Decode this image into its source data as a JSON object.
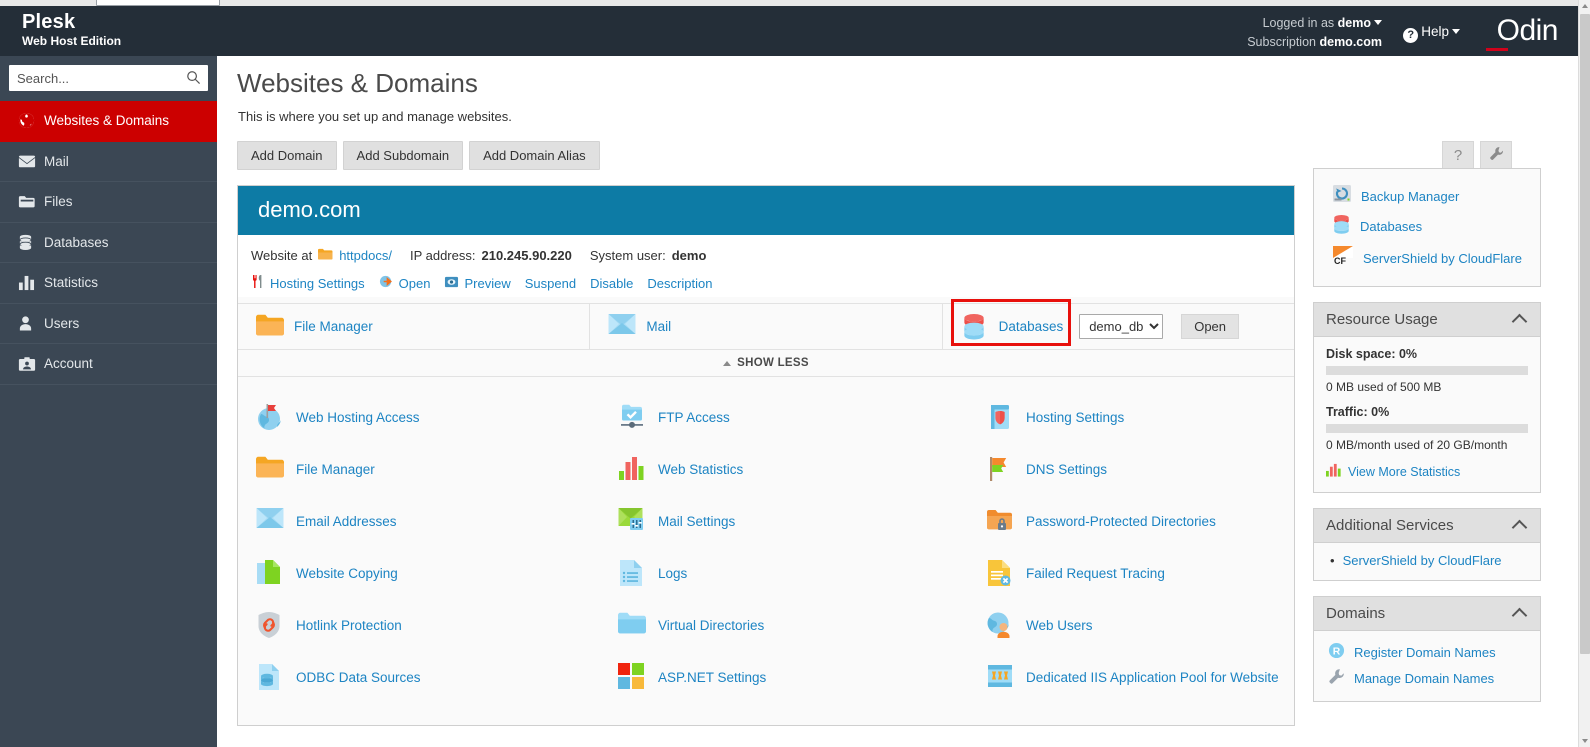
{
  "browser": {
    "strip": ""
  },
  "topbar": {
    "brand_name": "Plesk",
    "brand_sub": "Web Host Edition",
    "logged_in_label": "Logged in as",
    "logged_in_user": "demo",
    "subscription_label": "Subscription",
    "subscription_value": "demo.com",
    "help_label": "Help",
    "logo": "Odin",
    "accent_red": "#d0021b",
    "bg": "#242e38"
  },
  "sidebar": {
    "search": {
      "placeholder": "Search...",
      "value": "",
      "icon": "search-icon"
    },
    "active_color": "#cc0000",
    "bg": "#3b4754",
    "items": [
      {
        "label": "Websites & Domains",
        "icon": "globe-icon",
        "active": true
      },
      {
        "label": "Mail",
        "icon": "envelope-icon",
        "active": false
      },
      {
        "label": "Files",
        "icon": "folder-icon",
        "active": false
      },
      {
        "label": "Databases",
        "icon": "database-icon",
        "active": false
      },
      {
        "label": "Statistics",
        "icon": "bar-chart-icon",
        "active": false
      },
      {
        "label": "Users",
        "icon": "user-icon",
        "active": false
      },
      {
        "label": "Account",
        "icon": "account-card-icon",
        "active": false
      }
    ]
  },
  "main": {
    "page_title": "Websites & Domains",
    "page_description": "This is where you set up and manage websites.",
    "buttons": [
      {
        "label": "Add Domain"
      },
      {
        "label": "Add Subdomain"
      },
      {
        "label": "Add Domain Alias"
      }
    ],
    "square_buttons": [
      {
        "label": "?",
        "icon": "question-mark-icon"
      },
      {
        "label": "",
        "icon": "wrench-icon"
      }
    ]
  },
  "domain_panel": {
    "header_bg": "#0d7ba5",
    "title": "demo.com",
    "website_at_label": "Website at",
    "webroot": "httpdocs/",
    "ip_label": "IP address:",
    "ip_value": "210.245.90.220",
    "system_user_label": "System user:",
    "system_user_value": "demo",
    "actions": [
      {
        "label": "Hosting Settings",
        "icon": "tools-icon",
        "link": true
      },
      {
        "label": "Open",
        "icon": "open-arrow-icon",
        "link": true
      },
      {
        "label": "Preview",
        "icon": "preview-eye-icon",
        "link": true
      },
      {
        "label": "Suspend",
        "icon": "",
        "link": true
      },
      {
        "label": "Disable",
        "icon": "",
        "link": true
      },
      {
        "label": "Description",
        "icon": "",
        "link": true
      }
    ],
    "tools": [
      {
        "label": "File Manager",
        "icon": "folder-orange-icon"
      },
      {
        "label": "Mail",
        "icon": "envelope-blue-icon"
      },
      {
        "label": "Databases",
        "icon": "database-red-blue-icon",
        "highlighted": true
      }
    ],
    "highlight_color": "#e8100c",
    "db_select": {
      "value": "demo_db",
      "options": [
        "demo_db"
      ]
    },
    "open_button": "Open",
    "show_less": "SHOW LESS",
    "grid_items": [
      {
        "label": "Web Hosting Access",
        "icon": "globe-flag-icon"
      },
      {
        "label": "FTP Access",
        "icon": "ftp-folder-check-icon"
      },
      {
        "label": "Hosting Settings",
        "icon": "shield-panel-icon"
      },
      {
        "label": "File Manager",
        "icon": "folder-orange-icon"
      },
      {
        "label": "Web Statistics",
        "icon": "bar-chart-color-icon"
      },
      {
        "label": "DNS Settings",
        "icon": "flag-green-orange-icon"
      },
      {
        "label": "Email Addresses",
        "icon": "envelope-blue-icon"
      },
      {
        "label": "Mail Settings",
        "icon": "envelope-green-sliders-icon"
      },
      {
        "label": "Password-Protected Directories",
        "icon": "folder-lock-icon"
      },
      {
        "label": "Website Copying",
        "icon": "copy-pages-icon"
      },
      {
        "label": "Logs",
        "icon": "document-lines-icon"
      },
      {
        "label": "Failed Request Tracing",
        "icon": "document-error-icon"
      },
      {
        "label": "Hotlink Protection",
        "icon": "shield-link-icon"
      },
      {
        "label": "Virtual Directories",
        "icon": "folder-blue-icon"
      },
      {
        "label": "Web Users",
        "icon": "globe-user-icon"
      },
      {
        "label": "ODBC Data Sources",
        "icon": "document-database-icon"
      },
      {
        "label": "ASP.NET Settings",
        "icon": "windows-squares-icon"
      },
      {
        "label": "Dedicated IIS Application Pool for Website",
        "icon": "iis-pool-icon"
      }
    ]
  },
  "rail": {
    "quick_links": [
      {
        "label": "Backup Manager",
        "icon": "backup-restore-icon"
      },
      {
        "label": "Databases",
        "icon": "database-red-blue-icon"
      },
      {
        "label": "ServerShield by CloudFlare",
        "icon": "cloudflare-cf-icon"
      }
    ],
    "resource_usage": {
      "title": "Resource Usage",
      "collapse_icon": "chevron-up-icon",
      "disk_label": "Disk space: 0%",
      "disk_sub": "0 MB used of 500 MB",
      "disk_percent": 0,
      "traffic_label": "Traffic: 0%",
      "traffic_sub": "0 MB/month used of 20 GB/month",
      "traffic_percent": 0,
      "more_stats": "View More Statistics",
      "more_stats_icon": "bar-chart-color-icon"
    },
    "additional_services": {
      "title": "Additional Services",
      "collapse_icon": "chevron-up-icon",
      "items": [
        {
          "label": "ServerShield by CloudFlare"
        }
      ]
    },
    "domains": {
      "title": "Domains",
      "collapse_icon": "chevron-up-icon",
      "items": [
        {
          "label": "Register Domain Names",
          "icon": "registrar-r-icon"
        },
        {
          "label": "Manage Domain Names",
          "icon": "wrench-icon"
        }
      ]
    }
  },
  "scrollbar": {
    "position": "right"
  }
}
